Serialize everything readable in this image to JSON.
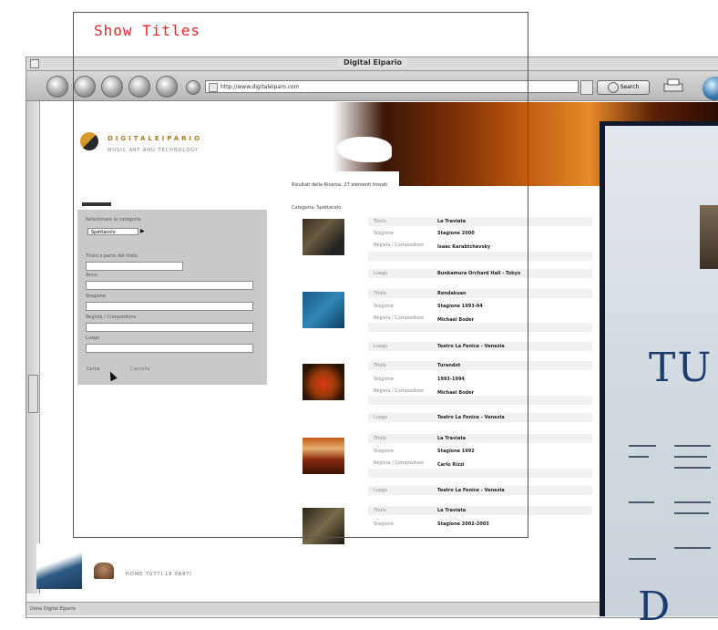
{
  "overlay": {
    "label": "Show Titles"
  },
  "browser": {
    "window_title": "Digital Eipario",
    "url": "http://www.digitaleiparo.com",
    "search_label": "Search"
  },
  "site": {
    "logo_text": "DIGITALEIPARIO",
    "logo_subtitle": "MUSIC ART AND TECHNOLOGY",
    "results_heading": "Risultati della Ricerca: 27 elementi trovati",
    "category_line": "Categoria: Spettacolo",
    "form": {
      "category_label": "Selezionare la categoria",
      "category_value": "Spettacolo",
      "arrow": "▶",
      "fields": [
        "Titolo o parte del titolo",
        "Anno",
        "Stagione",
        "Regista / Compositore",
        "Luogo"
      ],
      "search_button": "Cerca",
      "reset_button": "Cancella"
    },
    "results": [
      {
        "rows": [
          {
            "label": "Titolo",
            "value": "La Traviata"
          },
          {
            "label": "Stagione",
            "value": "Stagione 2000"
          },
          {
            "label": "Regista / Compositore",
            "value": "Isaac Karabtchevsky"
          },
          {
            "label": "Luogo",
            "value": "Bunkamura Orchard Hall - Tokyo"
          }
        ]
      },
      {
        "rows": [
          {
            "label": "Titolo",
            "value": "Rendakuan"
          },
          {
            "label": "Stagione",
            "value": "Stagione 1993-94"
          },
          {
            "label": "Regista / Compositore",
            "value": "Michael Boder"
          },
          {
            "label": "Luogo",
            "value": "Teatro La Fenice - Venezia"
          }
        ]
      },
      {
        "rows": [
          {
            "label": "Titolo",
            "value": "Turandot"
          },
          {
            "label": "Stagione",
            "value": "1993-1994"
          },
          {
            "label": "Regista / Compositore",
            "value": "Michael Boder"
          },
          {
            "label": "Luogo",
            "value": "Teatro La Fenice - Venezia"
          }
        ]
      },
      {
        "rows": [
          {
            "label": "Titolo",
            "value": "La Traviata"
          },
          {
            "label": "Stagione",
            "value": "Stagione 1992"
          },
          {
            "label": "Regista / Compositore",
            "value": "Carlo Rizzi"
          },
          {
            "label": "Luogo",
            "value": "Teatro La Fenice - Venezia"
          }
        ]
      },
      {
        "rows": [
          {
            "label": "Titolo",
            "value": "La Traviata"
          },
          {
            "label": "Stagione",
            "value": "Stagione 2002-2003"
          }
        ]
      }
    ],
    "footer_text": "HOME TUTTI LE PARTI",
    "status_text": "Done Digital Eipario"
  },
  "poster": {
    "title_fragment": "TU",
    "bottom_fragment": "D"
  }
}
